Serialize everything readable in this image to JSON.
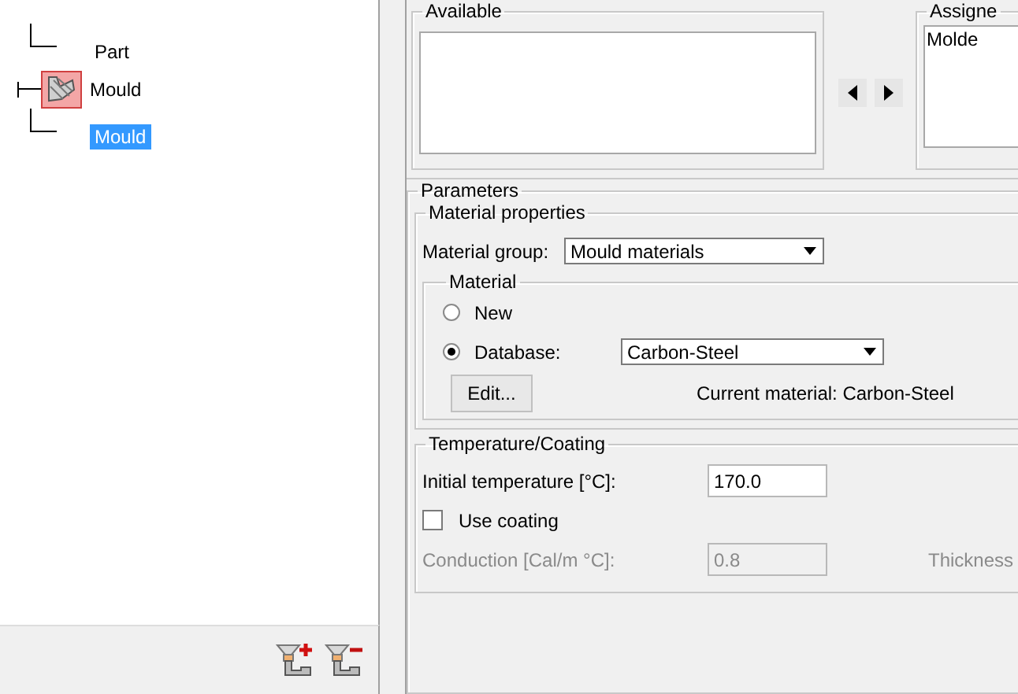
{
  "tree": [
    {
      "label": "Part",
      "selected": false
    },
    {
      "label": "Mould",
      "selected": false,
      "children": [
        {
          "label": "Mould",
          "selected": true
        }
      ]
    }
  ],
  "assignment": {
    "available": {
      "title": "Available"
    },
    "assigned": {
      "title": "Assigne",
      "items": [
        "Molde"
      ]
    }
  },
  "parameters": {
    "title": "Parameters",
    "material_properties": {
      "title": "Material properties",
      "group_label": "Material group:",
      "group_value": "Mould materials",
      "material": {
        "title": "Material",
        "options": [
          {
            "label": "New",
            "selected": false
          },
          {
            "label": "Database:",
            "selected": true
          }
        ],
        "database_value": "Carbon-Steel",
        "edit_button": "Edit...",
        "current": "Current material: Carbon-Steel"
      }
    },
    "temperature": {
      "title": "Temperature/Coating",
      "initial_label": "Initial temperature [°C]:",
      "initial_value": "170.0",
      "use_coating": {
        "label": "Use coating",
        "checked": false
      },
      "conduction_label": "Conduction [Cal/m °C]:",
      "conduction_value": "0.8",
      "thickness_label": "Thickness"
    }
  }
}
